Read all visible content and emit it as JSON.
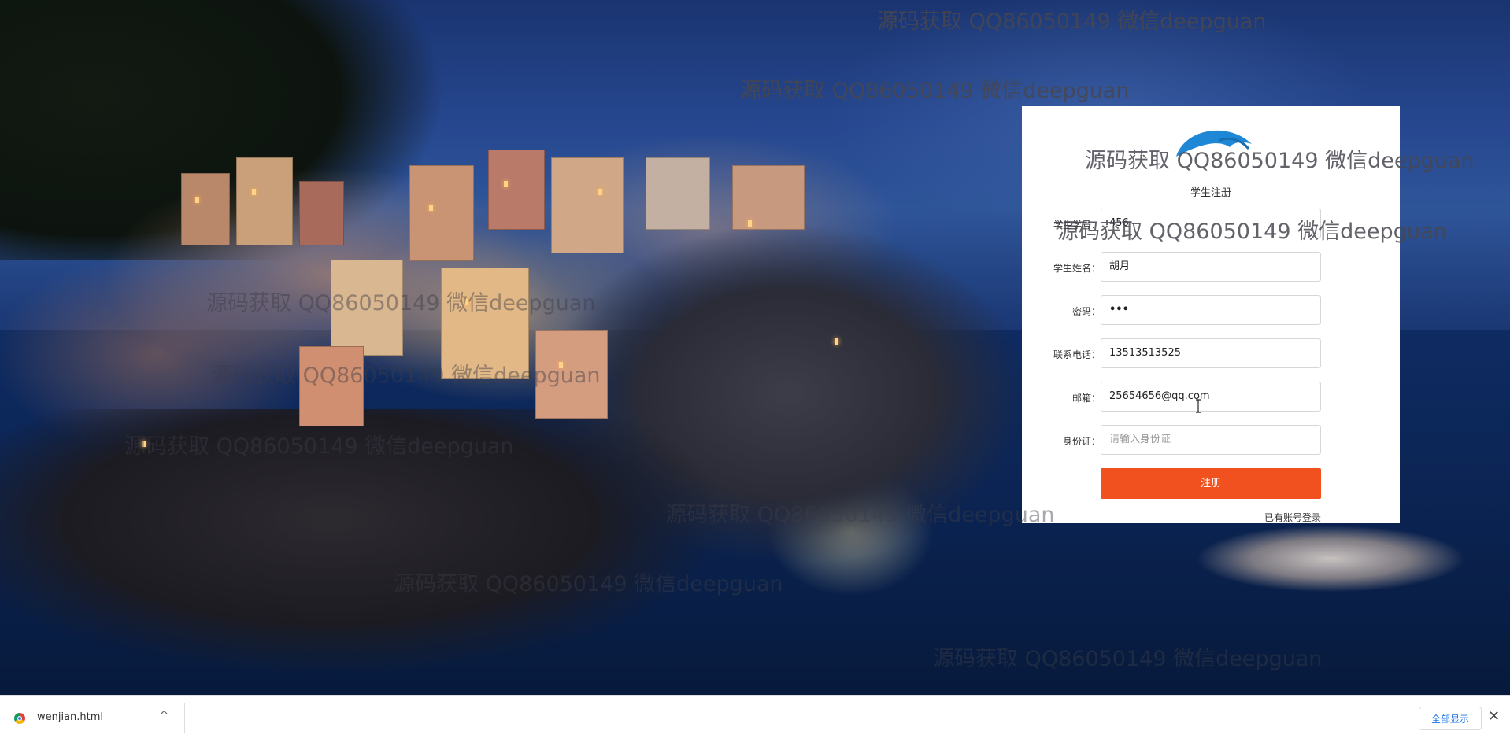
{
  "watermarks": [
    "源码获取 QQ86050149 微信deepguan",
    "源码获取 QQ86050149 微信deepguan",
    "源码获取 QQ86050149 微信deepguan",
    "源码获取 QQ86050149 微信deepguan",
    "源码获取 QQ86050149 微信deepguan",
    "源码获取 QQ86050149 微信deepguan",
    "源码获取 QQ86050149 微信deepguan",
    "源码获取 QQ86050149 微信deepguan",
    "源码获取 QQ86050149 微信deepguan",
    "源码获取 QQ86050149 微信deepguan"
  ],
  "form": {
    "title": "学生注册",
    "fields": [
      {
        "label": "学生学号：",
        "value": "456",
        "placeholder": ""
      },
      {
        "label": "学生姓名：",
        "value": "胡月",
        "placeholder": ""
      },
      {
        "label": "密码：",
        "value": "•••",
        "placeholder": ""
      },
      {
        "label": "联系电话：",
        "value": "13513513525",
        "placeholder": ""
      },
      {
        "label": "邮箱：",
        "value": "25654656@qq.com",
        "placeholder": ""
      },
      {
        "label": "身份证：",
        "value": "",
        "placeholder": "请输入身份证"
      }
    ],
    "submit_label": "注册",
    "login_link": "已有账号登录"
  },
  "download_bar": {
    "file_name": "wenjian.html",
    "chevron": "^",
    "show_all": "全部显示",
    "close": "✕"
  },
  "colors": {
    "submit_bg": "#f0511f",
    "logo_blue": "#1e88d6",
    "show_all_text": "#1a73e8"
  },
  "icons": {
    "browser": "chrome-icon",
    "chevron": "chevron-up-icon",
    "close": "close-icon",
    "logo": "hand-logo-icon"
  }
}
